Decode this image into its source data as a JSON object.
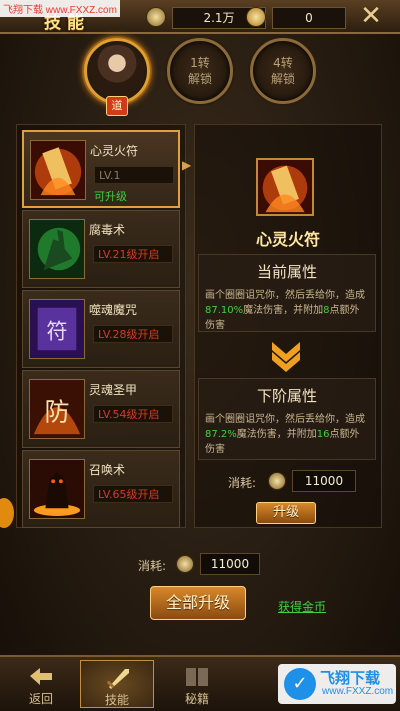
{
  "watermark": "飞翔下载 www.FXXZ.com",
  "header": {
    "title": "技能",
    "currency1": {
      "icon": "coin-stack-icon",
      "value": "2.1万"
    },
    "currency2": {
      "icon": "gold-ingot-icon",
      "value": "0"
    },
    "close": "✕"
  },
  "classes": [
    {
      "label": "道",
      "state": "active"
    },
    {
      "label": "1转\n解锁",
      "state": "locked"
    },
    {
      "label": "4转\n解锁",
      "state": "locked"
    }
  ],
  "skills": [
    {
      "name": "心灵火符",
      "level": "LV.1",
      "status": "可升级",
      "selected": true
    },
    {
      "name": "腐毒术",
      "level": "LV.21级开启",
      "status": "",
      "selected": false
    },
    {
      "name": "噬魂魔咒",
      "level": "LV.28级开启",
      "status": "",
      "selected": false
    },
    {
      "name": "灵魂圣甲",
      "level": "LV.54级开启",
      "status": "",
      "selected": false
    },
    {
      "name": "召唤术",
      "level": "LV.65级开启",
      "status": "",
      "selected": false
    }
  ],
  "detail": {
    "name": "心灵火符",
    "current_title": "当前属性",
    "current_desc": {
      "a": "画个圈圈诅咒你，然后丢给你，造成",
      "pct": "87.10%",
      "b": "魔法伤害，并附加",
      "num": "8",
      "c": "点额外伤害"
    },
    "next_title": "下阶属性",
    "next_desc": {
      "a": "画个圈圈诅咒你，然后丢给你，造成",
      "pct": "87.2%",
      "b": "魔法伤害，并附加",
      "num": "16",
      "c": "点额外伤害"
    },
    "cost_label": "消耗:",
    "cost_value": "11000",
    "upgrade_button": "升级"
  },
  "footer": {
    "cost_label": "消耗:",
    "cost_value": "11000",
    "upgrade_all_button": "全部升级",
    "get_gold_link": "获得金币"
  },
  "tabs": [
    {
      "label": "返回",
      "icon": "back-arrow-icon"
    },
    {
      "label": "技能",
      "icon": "sword-icon",
      "active": true
    },
    {
      "label": "秘籍",
      "icon": "book-icon"
    }
  ],
  "brand_overlay": {
    "name": "飞翔下载",
    "url": "www.FXXZ.com"
  },
  "colors": {
    "accent_gold": "#ffe28a",
    "locked_red": "#d83a20",
    "upgrade_green": "#3fcf3f"
  }
}
